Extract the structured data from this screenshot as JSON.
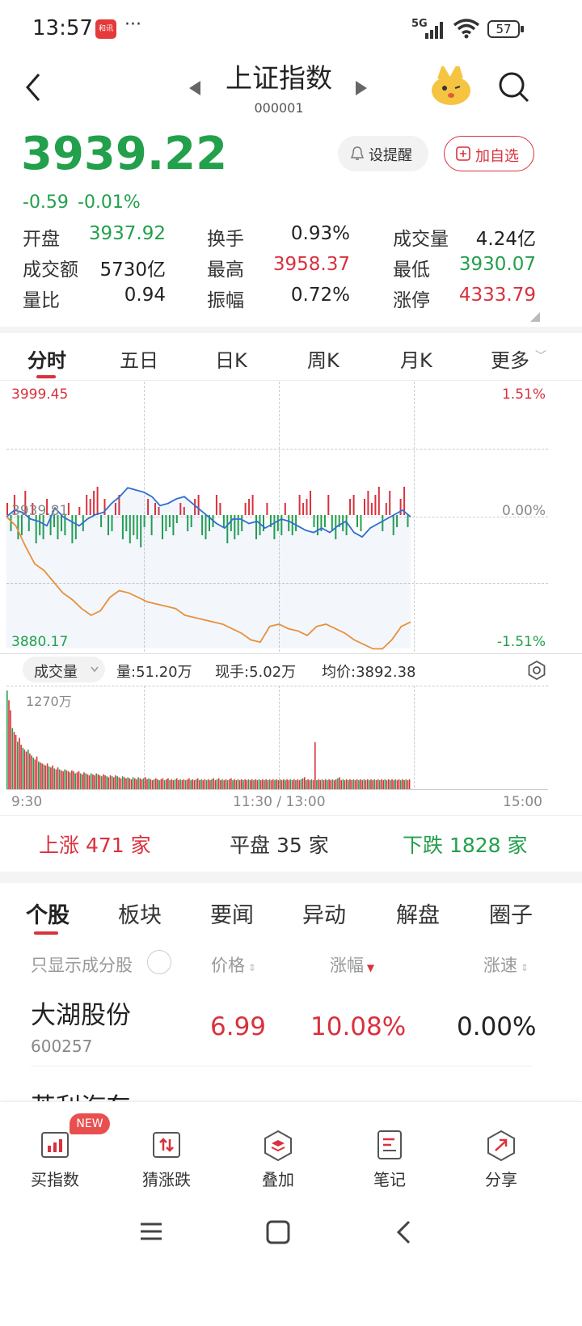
{
  "status": {
    "time": "13:57",
    "app_badge": "和讯",
    "dots": "···",
    "net": "5G",
    "battery": "57"
  },
  "header": {
    "title": "上证指数",
    "code": "000001"
  },
  "quote": {
    "price": "3939.22",
    "change": "-0.59",
    "change_pct": "-0.01%",
    "alert_label": "设提醒",
    "watch_label": "加自选"
  },
  "stats": [
    {
      "label": "开盘",
      "value": "3937.92",
      "color": "green"
    },
    {
      "label": "换手",
      "value": "0.93%",
      "color": "black"
    },
    {
      "label": "成交量",
      "value": "4.24亿",
      "color": "black"
    },
    {
      "label": "成交额",
      "value": "5730亿",
      "color": "black"
    },
    {
      "label": "最高",
      "value": "3958.37",
      "color": "red"
    },
    {
      "label": "最低",
      "value": "3930.07",
      "color": "green"
    },
    {
      "label": "量比",
      "value": "0.94",
      "color": "black"
    },
    {
      "label": "振幅",
      "value": "0.72%",
      "color": "black"
    },
    {
      "label": "涨停",
      "value": "4333.79",
      "color": "red"
    }
  ],
  "chart_tabs": [
    "分时",
    "五日",
    "日K",
    "周K",
    "月K",
    "更多"
  ],
  "chart_data": {
    "type": "line",
    "y_high": "3999.45",
    "y_mid": "3939.81",
    "y_low": "3880.17",
    "pct_high": "1.51%",
    "pct_mid": "0.00%",
    "pct_low": "-1.51%",
    "ylim": [
      3880.17,
      3999.45
    ],
    "x_labels": [
      "9:30",
      "11:30 / 13:00",
      "15:00"
    ],
    "series": [
      {
        "values": [
          3939,
          3942,
          3941,
          3938,
          3937,
          3935,
          3943,
          3939,
          3937,
          3935,
          3938,
          3940,
          3941,
          3945,
          3948,
          3952,
          3951,
          3950,
          3948,
          3944,
          3945,
          3947,
          3948,
          3945,
          3942,
          3939,
          3936,
          3934,
          3938,
          3938,
          3936,
          3937,
          3934,
          3936,
          3938,
          3937,
          3935,
          3933,
          3932,
          3934,
          3932,
          3935,
          3937,
          3932,
          3930,
          3934,
          3936,
          3938,
          3940,
          3942,
          3939
        ]
      },
      {
        "values": [
          3939,
          3935,
          3926,
          3918,
          3915,
          3910,
          3905,
          3902,
          3898,
          3895,
          3897,
          3903,
          3906,
          3905,
          3903,
          3901,
          3900,
          3899,
          3898,
          3895,
          3894,
          3893,
          3892,
          3891,
          3889,
          3887,
          3884,
          3883,
          3890,
          3891,
          3889,
          3888,
          3886,
          3890,
          3891,
          3889,
          3887,
          3884,
          3882,
          3880,
          3880,
          3884,
          3890,
          3892
        ]
      }
    ],
    "minute_bars": [
      3,
      -4,
      5,
      -6,
      -5,
      6,
      -4,
      3,
      -7,
      -5,
      -6,
      4,
      -5,
      -3,
      -6,
      -4,
      -5,
      3,
      -7,
      -6,
      2,
      -4,
      5,
      4,
      6,
      7,
      -3,
      4,
      -5,
      -4,
      3,
      5,
      -6,
      -4,
      -7,
      -5,
      -6,
      -8,
      -3,
      4,
      -5,
      3,
      2,
      -6,
      -4,
      -3,
      -5,
      -2,
      3,
      2,
      -4,
      -3,
      4,
      5,
      -5,
      -6,
      -4,
      -3,
      5,
      3,
      -3,
      -7,
      -4,
      -6,
      -5,
      -4,
      3,
      4,
      5,
      -6,
      -5,
      -4,
      3,
      -3,
      -6,
      -4,
      -5,
      3,
      -4,
      -5,
      -4,
      5,
      3,
      4,
      6,
      -3,
      -5,
      -4,
      -3,
      5,
      -4,
      -6,
      -3,
      -4,
      -5,
      4,
      5,
      -3,
      -4,
      4,
      6,
      3,
      5,
      7,
      -4,
      3,
      6,
      -5,
      -3,
      4,
      7,
      -3
    ],
    "volume_label": "成交量",
    "volume_info": "量:51.20万",
    "current_vol": "现手:5.02万",
    "avg_price": "均价:3892.38",
    "vol_max_label": "1270万",
    "volumes": [
      100,
      90,
      80,
      62,
      58,
      55,
      48,
      52,
      45,
      42,
      40,
      38,
      40,
      36,
      34,
      32,
      30,
      33,
      28,
      27,
      26,
      25,
      24,
      26,
      23,
      22,
      24,
      21,
      20,
      22,
      20,
      19,
      18,
      20,
      19,
      18,
      17,
      19,
      18,
      16,
      17,
      18,
      16,
      15,
      17,
      16,
      15,
      14,
      16,
      15,
      14,
      16,
      15,
      14,
      13,
      15,
      14,
      13,
      12,
      14,
      13,
      12,
      14,
      13,
      12,
      11,
      13,
      12,
      11,
      12,
      11,
      10,
      12,
      11,
      10,
      12,
      11,
      10,
      11,
      12,
      10,
      11,
      10,
      9,
      10,
      11,
      10,
      9,
      10,
      11,
      9,
      10,
      11,
      9,
      10,
      9,
      10,
      11,
      9,
      10,
      9,
      10,
      9,
      10,
      11,
      9,
      10,
      9,
      10,
      11,
      9,
      10,
      9,
      10,
      9,
      10,
      9,
      10,
      11,
      9,
      10,
      11,
      9,
      10,
      9,
      10,
      9,
      10,
      11,
      9,
      10,
      9,
      10,
      9,
      10,
      9,
      10,
      9,
      10,
      9,
      10,
      9,
      10,
      9,
      10,
      9,
      10,
      9,
      10,
      9,
      10,
      9,
      10,
      9,
      10,
      9,
      10,
      9,
      10,
      9,
      10,
      9,
      10,
      9,
      10,
      9,
      10,
      9,
      10,
      11,
      12,
      9,
      10,
      9,
      10,
      9,
      10,
      9,
      10,
      9,
      10,
      9,
      10,
      9,
      10,
      9,
      10,
      9,
      10,
      11,
      12,
      9,
      10,
      9,
      10,
      9,
      10,
      9,
      10,
      9,
      10,
      9,
      10,
      9,
      10,
      9,
      10,
      9,
      10,
      9,
      10,
      9,
      10,
      9,
      10,
      9,
      10,
      9,
      10,
      9,
      10,
      9,
      10,
      9,
      10,
      9,
      10,
      9,
      10,
      9,
      10
    ]
  },
  "breadth": {
    "up": "上涨 471 家",
    "flat": "平盘 35 家",
    "down": "下跌 1828 家"
  },
  "sub_tabs": [
    "个股",
    "板块",
    "要闻",
    "异动",
    "解盘",
    "圈子"
  ],
  "list_header": {
    "filter": "只显示成分股",
    "price": "价格",
    "chg": "涨幅",
    "speed": "涨速"
  },
  "stocks": [
    {
      "name": "大湖股份",
      "code": "600257",
      "price": "6.99",
      "chg": "10.08%",
      "speed": "0.00%"
    },
    {
      "name": "英利汽车",
      "code": "",
      "price": "",
      "chg": "",
      "speed": ""
    }
  ],
  "bottom_nav": [
    {
      "label": "买指数",
      "icon": "bar-chart-icon",
      "badge": "NEW"
    },
    {
      "label": "猜涨跌",
      "icon": "updown-icon"
    },
    {
      "label": "叠加",
      "icon": "layers-icon"
    },
    {
      "label": "笔记",
      "icon": "note-icon"
    },
    {
      "label": "分享",
      "icon": "share-icon"
    }
  ]
}
